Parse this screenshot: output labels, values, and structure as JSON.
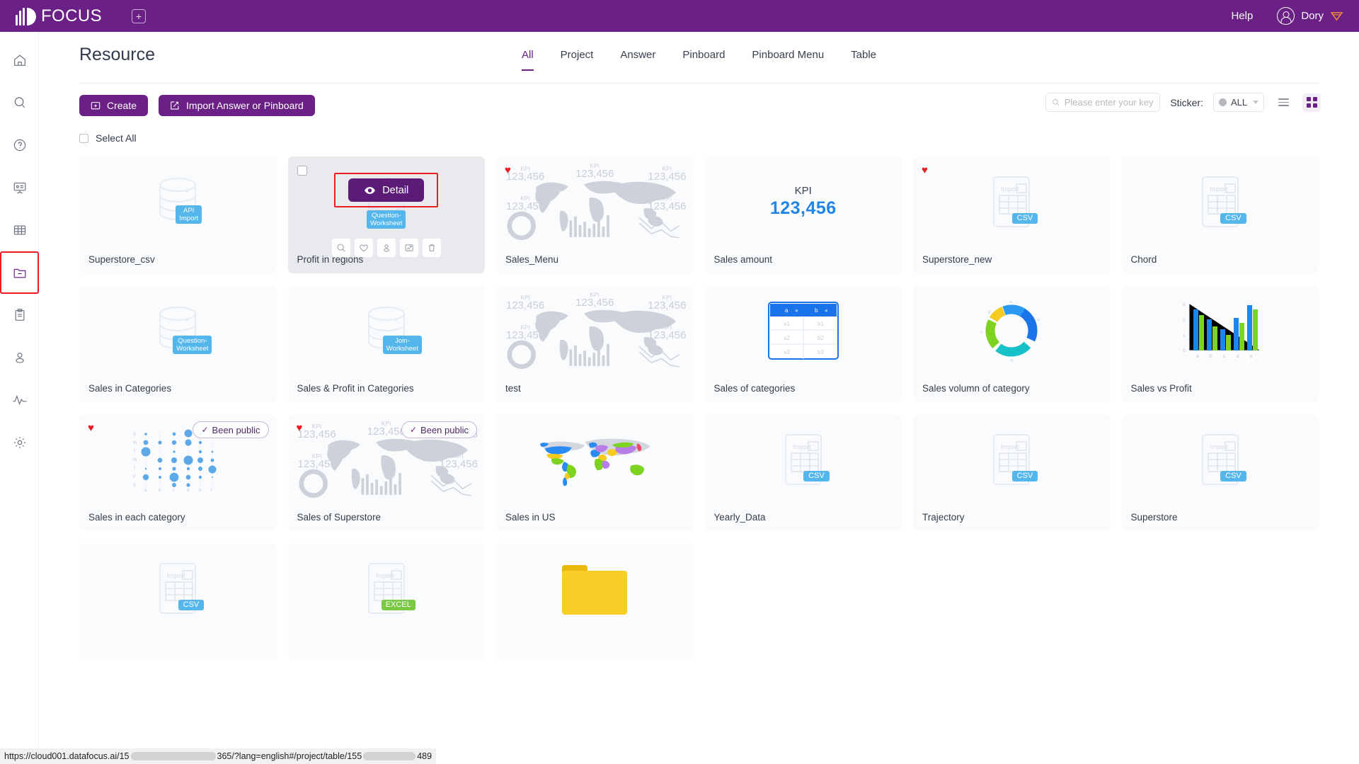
{
  "topbar": {
    "brand": "FOCUS",
    "add_icon": "plus-square-icon",
    "help": "Help",
    "user": "Dory"
  },
  "sidebar": {
    "items": [
      {
        "icon": "home-icon",
        "name": "home"
      },
      {
        "icon": "search-icon",
        "name": "search"
      },
      {
        "icon": "question-circle-icon",
        "name": "help"
      },
      {
        "icon": "presentation-icon",
        "name": "presentation"
      },
      {
        "icon": "table-grid-icon",
        "name": "table"
      },
      {
        "icon": "folder-icon",
        "name": "resource"
      },
      {
        "icon": "clipboard-icon",
        "name": "clipboard"
      },
      {
        "icon": "user-icon",
        "name": "user"
      },
      {
        "icon": "pulse-icon",
        "name": "monitor"
      },
      {
        "icon": "gear-icon",
        "name": "settings"
      }
    ],
    "active_index": 5
  },
  "page": {
    "title": "Resource"
  },
  "tabs": [
    {
      "label": "All",
      "active": true
    },
    {
      "label": "Project",
      "active": false
    },
    {
      "label": "Answer",
      "active": false
    },
    {
      "label": "Pinboard",
      "active": false
    },
    {
      "label": "Pinboard Menu",
      "active": false
    },
    {
      "label": "Table",
      "active": false
    }
  ],
  "toolbar": {
    "create_label": "Create",
    "import_label": "Import Answer or Pinboard",
    "search_placeholder": "Please enter your keywo",
    "sticker_label": "Sticker:",
    "sticker_value": "ALL",
    "select_all_label": "Select All",
    "view_list_icon": "list-view-icon",
    "view_grid_icon": "grid-view-icon"
  },
  "overlay_card": {
    "detail_label": "Detail",
    "detail_icon": "eye-icon",
    "actions": [
      {
        "icon": "search-icon",
        "name": "preview"
      },
      {
        "icon": "heart-icon",
        "name": "favorite"
      },
      {
        "icon": "user-icon",
        "name": "share-user"
      },
      {
        "icon": "image-export-icon",
        "name": "export"
      },
      {
        "icon": "trash-icon",
        "name": "delete"
      }
    ]
  },
  "badges": {
    "been_public": "Been public",
    "api_import": "API Import",
    "question_worksheet": "Question-\nWorksheet",
    "join_worksheet": "Join-\nWorksheet",
    "csv": "CSV",
    "excel": "EXCEL",
    "import": "Import",
    "kpi": "KPI",
    "kpi_value": "123,456"
  },
  "cards": [
    {
      "title": "Superstore_csv",
      "thumb": "db-api",
      "fav": false,
      "public": false,
      "selected": false
    },
    {
      "title": "Profit in regions",
      "thumb": "db-question",
      "fav": false,
      "public": false,
      "selected": true
    },
    {
      "title": "Sales_Menu",
      "thumb": "dashboard",
      "fav": true,
      "public": false,
      "selected": false
    },
    {
      "title": "Sales amount",
      "thumb": "kpi",
      "fav": false,
      "public": false,
      "selected": false
    },
    {
      "title": "Superstore_new",
      "thumb": "file-csv",
      "fav": true,
      "public": false,
      "selected": false
    },
    {
      "title": "Chord",
      "thumb": "file-csv",
      "fav": false,
      "public": false,
      "selected": false
    },
    {
      "title": "Sales in Categories",
      "thumb": "db-question",
      "fav": false,
      "public": false,
      "selected": false
    },
    {
      "title": "Sales & Profit in Categories",
      "thumb": "db-join",
      "fav": false,
      "public": false,
      "selected": false
    },
    {
      "title": "test",
      "thumb": "dashboard",
      "fav": false,
      "public": false,
      "selected": false
    },
    {
      "title": "Sales of categories",
      "thumb": "table",
      "fav": false,
      "public": false,
      "selected": false
    },
    {
      "title": "Sales volumn of category",
      "thumb": "donut",
      "fav": false,
      "public": false,
      "selected": false
    },
    {
      "title": "Sales vs Profit",
      "thumb": "bars",
      "fav": false,
      "public": false,
      "selected": false
    },
    {
      "title": "Sales in each category",
      "thumb": "bubble",
      "fav": true,
      "public": true,
      "selected": false
    },
    {
      "title": "Sales of Superstore",
      "thumb": "dashboard",
      "fav": true,
      "public": true,
      "selected": false
    },
    {
      "title": "Sales in US",
      "thumb": "worldmap",
      "fav": false,
      "public": false,
      "selected": false
    },
    {
      "title": "Yearly_Data",
      "thumb": "file-csv",
      "fav": false,
      "public": false,
      "selected": false
    },
    {
      "title": "Trajectory",
      "thumb": "file-csv",
      "fav": false,
      "public": false,
      "selected": false
    },
    {
      "title": "Superstore",
      "thumb": "file-csv",
      "fav": false,
      "public": false,
      "selected": false
    },
    {
      "title": "",
      "thumb": "file-csv",
      "fav": false,
      "public": false,
      "selected": false
    },
    {
      "title": "",
      "thumb": "file-excel",
      "fav": false,
      "public": false,
      "selected": false
    },
    {
      "title": "",
      "thumb": "folder",
      "fav": false,
      "public": false,
      "selected": false
    }
  ],
  "statusbar": {
    "prefix": "https://cloud001.datafocus.ai/15",
    "middle": "365/?lang=english#/project/table/155",
    "suffix": "489"
  },
  "colors": {
    "brand_purple": "#6b2086",
    "highlight_red": "#ec1c24",
    "accent_blue": "#2286e6",
    "tag_blue": "#55b6ec",
    "tag_green": "#7ac943",
    "folder_yellow": "#f8cd2a"
  }
}
